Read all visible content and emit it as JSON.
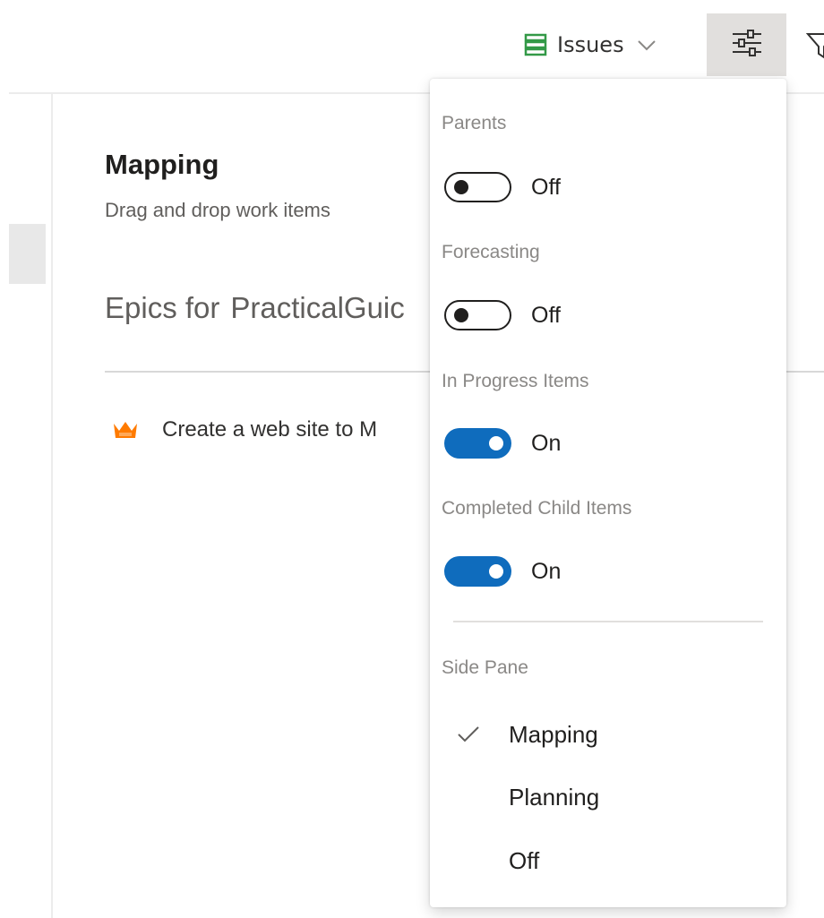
{
  "toolbar": {
    "backlog_label": "Issues",
    "backlog_icon": "backlog-list-icon",
    "settings_icon": "view-options-icon",
    "filter_icon": "filter-icon",
    "accent_green": "#339947"
  },
  "mapping": {
    "title": "Mapping",
    "subtitle": "Drag and drop work items",
    "epics_prefix": "Epics for",
    "project": "PracticalGuic",
    "epic_icon": "epic-crown-icon",
    "epic_color": "#ff7b00",
    "epic_title": "Create a web site to M"
  },
  "view_options": {
    "sections": [
      {
        "label": "Parents",
        "state_label": "Off",
        "on": false
      },
      {
        "label": "Forecasting",
        "state_label": "Off",
        "on": false
      },
      {
        "label": "In Progress Items",
        "state_label": "On",
        "on": true
      },
      {
        "label": "Completed Child Items",
        "state_label": "On",
        "on": true
      }
    ],
    "side_pane": {
      "label": "Side Pane",
      "options": [
        {
          "label": "Mapping",
          "selected": true
        },
        {
          "label": "Planning",
          "selected": false
        },
        {
          "label": "Off",
          "selected": false
        }
      ]
    },
    "toggle_on_color": "#0f6cbd"
  }
}
